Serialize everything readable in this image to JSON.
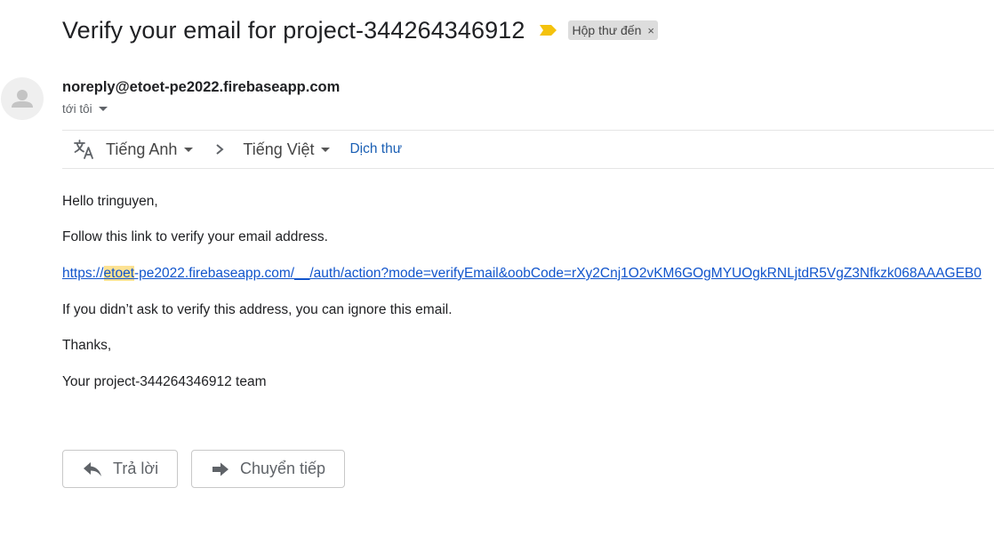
{
  "email": {
    "subject": "Verify your email for project-344264346912",
    "label": "Hộp thư đến",
    "label_remove": "×",
    "importance_icon": "importance-marker-icon",
    "sender": "noreply@etoet-pe2022.firebaseapp.com",
    "recipient": "tới tôi"
  },
  "translate": {
    "source_lang": "Tiếng Anh",
    "target_lang": "Tiếng Việt",
    "translate_link": "Dịch thư"
  },
  "body": {
    "greeting": "Hello tringuyen,",
    "instruction": "Follow this link to verify your email address.",
    "link_prefix": "https://",
    "link_highlight": "etoet",
    "link_rest": "-pe2022.firebaseapp.com/__/auth/action?mode=verifyEmail&oobCode=rXy2Cnj1O2vKM6GOgMYUOgkRNLjtdR5VgZ3Nfkzk068AAAGEB0",
    "ignore_note": "If you didn’t ask to verify this address, you can ignore this email.",
    "thanks": "Thanks,",
    "signature": "Your project-344264346912 team"
  },
  "actions": {
    "reply": "Trả lời",
    "forward": "Chuyển tiếp"
  },
  "colors": {
    "link": "#1155cc",
    "highlight": "#fde293",
    "importance": "#f4c20d"
  }
}
